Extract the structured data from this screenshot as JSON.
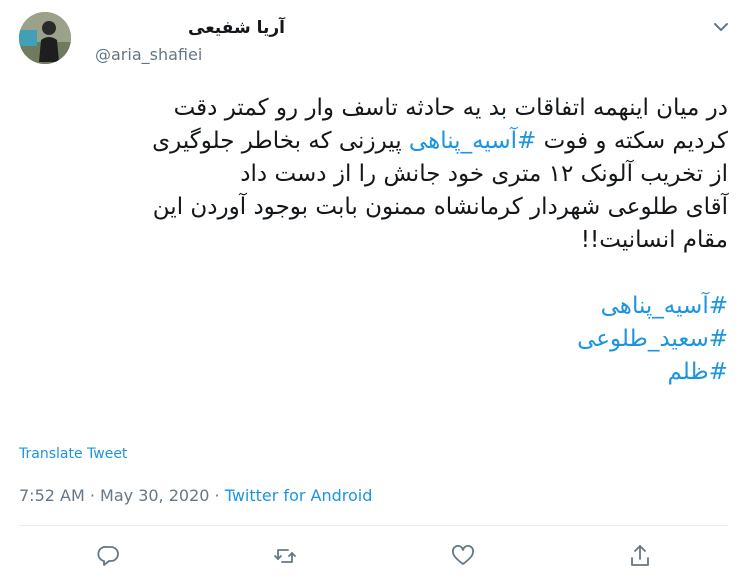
{
  "user": {
    "display_name": "آریا شفیعی",
    "handle": "@aria_shafiei",
    "avatar_icon": "user-avatar-photo"
  },
  "menu_icon": "chevron-down-icon",
  "tweet": {
    "lines": [
      "در میان اینهمه اتفاقات بد یه حادثه تاسف وار رو کمتر دقت",
      "کردیم سکته و فوت ",
      "#آسیه_پناهی",
      " پیرزنی که بخاطر جلوگیری",
      "از تخریب آلونک ۱۲ متری خود جانش را از دست داد",
      "آقای طلوعی شهردار کرمانشاه ممنون بابت بوجود آوردن این",
      "مقام انسانیت!!"
    ],
    "hashtags": [
      "#آسیه_پناهی",
      "#سعید_طلوعی",
      "#ظلم"
    ]
  },
  "translate_label": "Translate Tweet",
  "meta": {
    "time": "7:52 AM",
    "separator": " · ",
    "date": "May 30, 2020",
    "source": "Twitter for Android"
  },
  "actions": {
    "reply_icon": "reply-icon",
    "retweet_icon": "retweet-icon",
    "like_icon": "like-icon",
    "share_icon": "share-icon"
  },
  "colors": {
    "link": "#1b95e0",
    "secondary": "#657786",
    "text": "#14171a",
    "divider": "#e6ecf0"
  }
}
